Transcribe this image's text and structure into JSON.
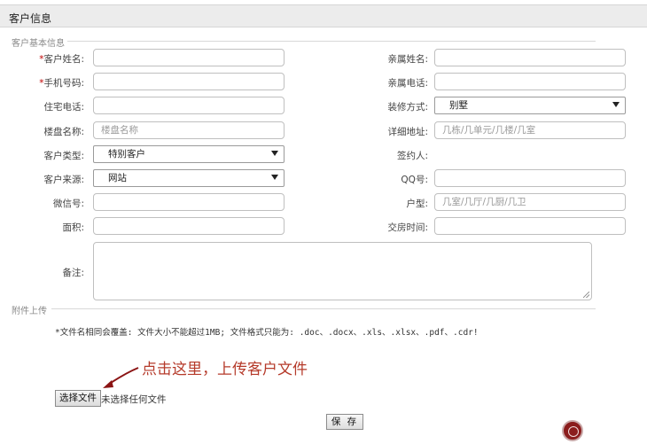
{
  "header": {
    "title": "客户信息"
  },
  "basic_section": {
    "legend": "客户基本信息"
  },
  "left_fields": [
    {
      "label": "客户姓名:",
      "required": "*",
      "type": "input",
      "value": "",
      "placeholder": ""
    },
    {
      "label": "手机号码:",
      "required": "*",
      "type": "input",
      "value": "",
      "placeholder": ""
    },
    {
      "label": "住宅电话:",
      "required": "",
      "type": "input",
      "value": "",
      "placeholder": ""
    },
    {
      "label": "楼盘名称:",
      "required": "",
      "type": "input",
      "value": "",
      "placeholder": "楼盘名称"
    },
    {
      "label": "客户类型:",
      "required": "",
      "type": "select",
      "value": "特别客户",
      "placeholder": ""
    },
    {
      "label": "客户来源:",
      "required": "",
      "type": "select",
      "value": "网站",
      "placeholder": ""
    },
    {
      "label": "微信号:",
      "required": "",
      "type": "input",
      "value": "",
      "placeholder": ""
    },
    {
      "label": "面积:",
      "required": "",
      "type": "input",
      "value": "",
      "placeholder": ""
    }
  ],
  "right_fields": [
    {
      "label": "亲属姓名:",
      "type": "input",
      "value": "",
      "placeholder": ""
    },
    {
      "label": "亲属电话:",
      "type": "input",
      "value": "",
      "placeholder": ""
    },
    {
      "label": "装修方式:",
      "type": "select",
      "value": "别墅",
      "placeholder": ""
    },
    {
      "label": "详细地址:",
      "type": "input",
      "value": "",
      "placeholder": "几栋/几单元/几楼/几室"
    },
    {
      "label": "签约人:",
      "type": "text",
      "value": "",
      "placeholder": ""
    },
    {
      "label": "QQ号:",
      "type": "input",
      "value": "",
      "placeholder": ""
    },
    {
      "label": "户型:",
      "type": "input",
      "value": "",
      "placeholder": "几室/几厅/几厨/几卫"
    },
    {
      "label": "交房时间:",
      "type": "input",
      "value": "",
      "placeholder": ""
    }
  ],
  "remarks": {
    "label": "备注:"
  },
  "attachment_section": {
    "legend": "附件上传",
    "note": "*文件名相同会覆盖: 文件大小不能超过1MB; 文件格式只能为: .doc、.docx、.xls、.xlsx、.pdf、.cdr!",
    "annotation": "点击这里，上传客户文件",
    "file_button": "选择文件",
    "file_status": "未选择任何文件"
  },
  "actions": {
    "save_label": "保 存"
  },
  "icons": {
    "arrow": "arrow-pointing-icon",
    "logo": "seal-logo-icon"
  },
  "colors": {
    "required": "#c00000",
    "annotation": "#b53a2a",
    "logo": "#8b1d1d"
  }
}
